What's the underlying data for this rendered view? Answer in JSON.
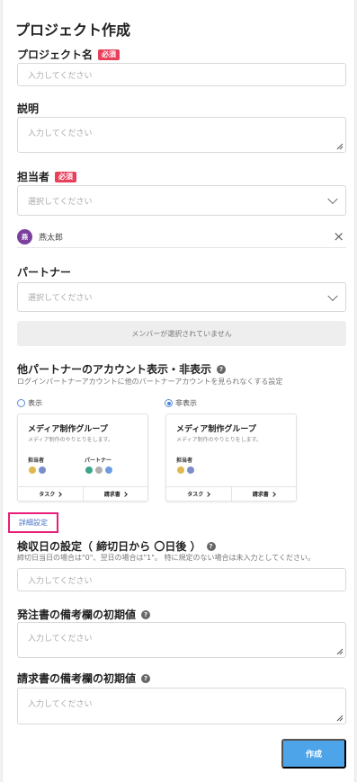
{
  "page": {
    "title": "プロジェクト作成"
  },
  "required_badge": "必須",
  "project_name": {
    "label": "プロジェクト名",
    "placeholder": "入力してください"
  },
  "description": {
    "label": "説明",
    "placeholder": "入力してください"
  },
  "assignee": {
    "label": "担当者",
    "placeholder": "選択してください",
    "selected": {
      "avatar_text": "燕",
      "name": "燕太郎"
    }
  },
  "partner": {
    "label": "パートナー",
    "placeholder": "選択してください",
    "empty_message": "メンバーが選択されていません"
  },
  "visibility": {
    "label": "他パートナーのアカウント表示・非表示",
    "description": "ログインパートナーアカウントに他のパートナーアカウントを見られなくする設定",
    "selected": "hide",
    "options": [
      {
        "label": "表示",
        "card": {
          "group": "メディア制作グループ",
          "sub": "メディア制作のやりとりをします。",
          "roles": [
            "担当者",
            "パートナー"
          ],
          "buttons": [
            "タスク",
            "請求書"
          ]
        }
      },
      {
        "label": "非表示",
        "card": {
          "group": "メディア制作グループ",
          "sub": "メディア制作のやりとりをします。",
          "roles": [
            "担当者"
          ],
          "buttons": [
            "タスク",
            "請求書"
          ]
        }
      }
    ]
  },
  "detail_settings": {
    "label": "詳細設定"
  },
  "inspection": {
    "label": "検収日の設定（ 締切日から 〇日後 ）",
    "description": "締切日当日の場合は\"0\"、翌日の場合は\"1\"。 特に規定のない場合は未入力としてください。",
    "placeholder": "入力してください"
  },
  "po_note": {
    "label": "発注書の備考欄の初期値",
    "placeholder": "入力してください"
  },
  "invoice_note": {
    "label": "請求書の備考欄の初期値",
    "placeholder": "入力してください"
  },
  "actions": {
    "create": "作成"
  },
  "colors": {
    "accent": "#4da4e8",
    "required": "#e83f5b",
    "detail_highlight": "#e91e7a",
    "avatar": "#7b3f9e"
  }
}
